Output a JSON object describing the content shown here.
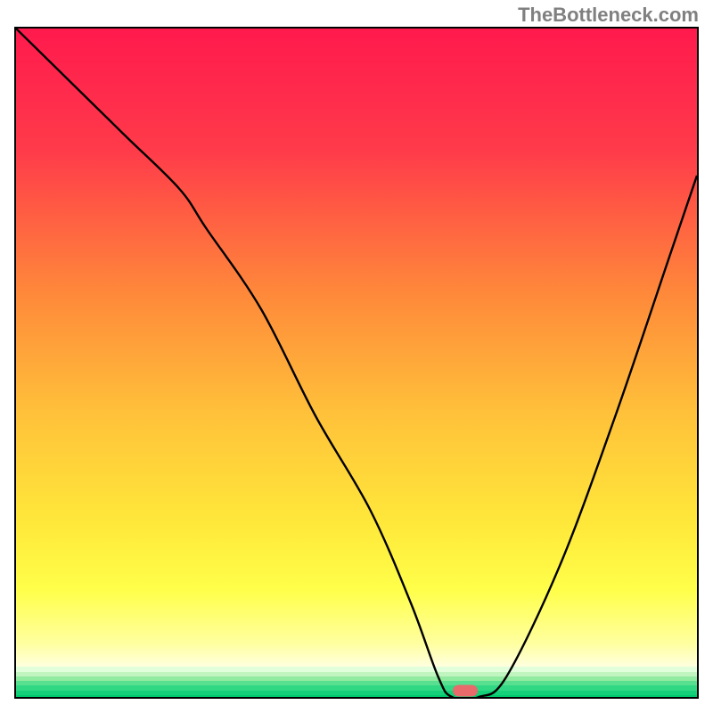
{
  "watermark": "TheBottleneck.com",
  "chart_data": {
    "type": "line",
    "title": "",
    "xlabel": "",
    "ylabel": "",
    "xlim": [
      0,
      100
    ],
    "ylim": [
      0,
      100
    ],
    "series": [
      {
        "name": "bottleneck-curve",
        "x": [
          0,
          8,
          16,
          24,
          28,
          36,
          44,
          52,
          58,
          62,
          64,
          68,
          72,
          80,
          88,
          96,
          100
        ],
        "values": [
          100,
          92,
          84,
          76,
          70,
          58,
          42,
          28,
          14,
          3,
          0,
          0,
          3,
          20,
          42,
          66,
          78
        ]
      }
    ],
    "marker": {
      "x": 66,
      "y": 0
    },
    "gradient_stops": [
      {
        "pos": 0.0,
        "color": "#ff1a4d"
      },
      {
        "pos": 0.18,
        "color": "#ff3a4a"
      },
      {
        "pos": 0.4,
        "color": "#ff8a3a"
      },
      {
        "pos": 0.58,
        "color": "#ffc23a"
      },
      {
        "pos": 0.74,
        "color": "#ffe83a"
      },
      {
        "pos": 0.84,
        "color": "#ffff4a"
      },
      {
        "pos": 0.92,
        "color": "#ffffa0"
      },
      {
        "pos": 0.955,
        "color": "#ffffe0"
      }
    ],
    "green_bands": [
      {
        "top": 0.955,
        "color": "#e0ffda"
      },
      {
        "top": 0.962,
        "color": "#c0f5c0"
      },
      {
        "top": 0.969,
        "color": "#90eaa0"
      },
      {
        "top": 0.976,
        "color": "#58e090"
      },
      {
        "top": 0.983,
        "color": "#30d884"
      },
      {
        "top": 0.99,
        "color": "#14d078"
      },
      {
        "top": 0.997,
        "color": "#00c86c"
      }
    ]
  }
}
